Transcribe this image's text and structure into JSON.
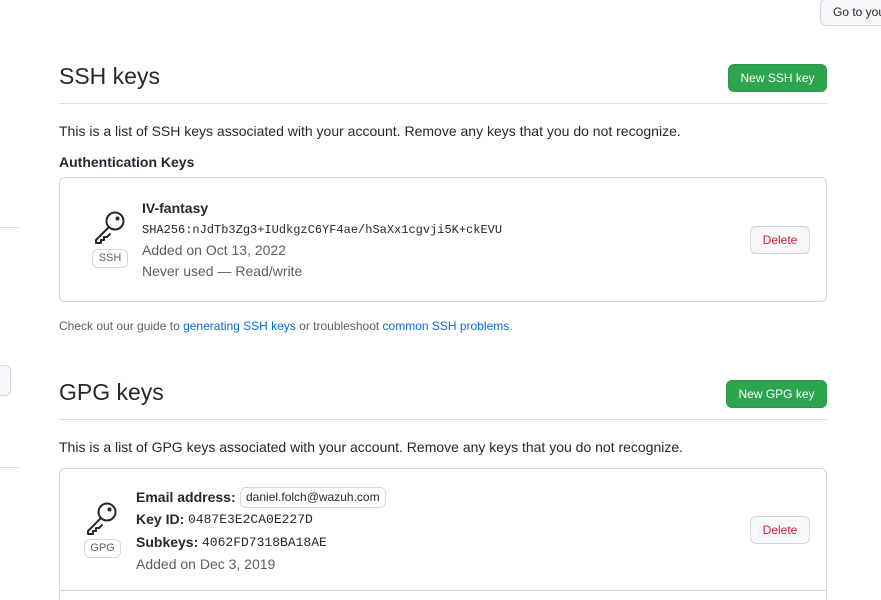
{
  "header": {
    "goto_label": "Go to your"
  },
  "ssh": {
    "title": "SSH keys",
    "new_button": "New SSH key",
    "description": "This is a list of SSH keys associated with your account. Remove any keys that you do not recognize.",
    "subheading": "Authentication Keys",
    "keys": [
      {
        "name": "IV-fantasy",
        "badge": "SSH",
        "fingerprint": "SHA256:nJdTb3Zg3+IUdkgzC6YF4ae/hSaXx1cgvji5K+ckEVU",
        "added": "Added on Oct 13, 2022",
        "usage": "Never used — Read/write",
        "delete_label": "Delete"
      }
    ],
    "help": {
      "prefix": "Check out our guide to ",
      "link1": "generating SSH keys",
      "middle": " or troubleshoot ",
      "link2": "common SSH problems",
      "suffix": "."
    }
  },
  "gpg": {
    "title": "GPG keys",
    "new_button": "New GPG key",
    "description": "This is a list of GPG keys associated with your account. Remove any keys that you do not recognize.",
    "keys": [
      {
        "badge": "GPG",
        "email_label": "Email address:",
        "email": "daniel.folch@wazuh.com",
        "keyid_label": "Key ID:",
        "keyid": "0487E3E2CA0E227D",
        "subkeys_label": "Subkeys:",
        "subkeys": "4062FD7318BA18AE",
        "added": "Added on Dec 3, 2019",
        "delete_label": "Delete"
      }
    ]
  },
  "icons": {
    "key": "key-icon"
  },
  "colors": {
    "primary_button": "#2da44e",
    "danger_text": "#cf222e",
    "link": "#0969da"
  }
}
